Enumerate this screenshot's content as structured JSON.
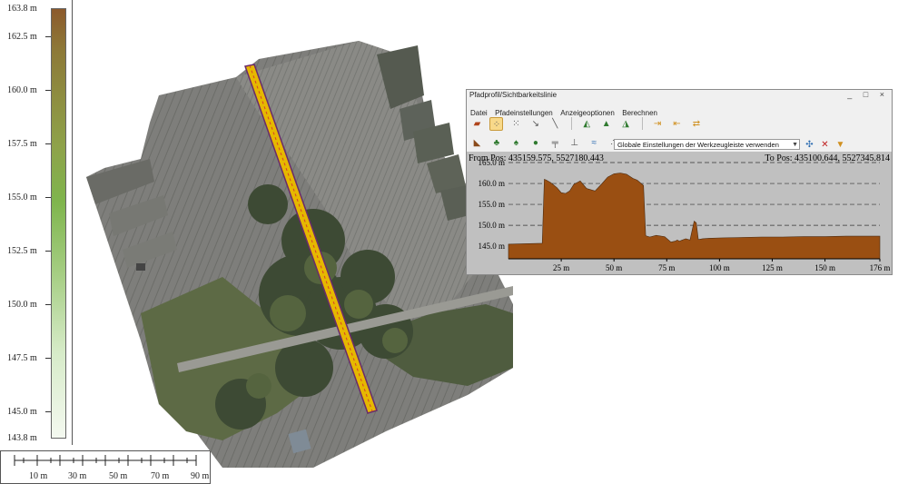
{
  "legend": {
    "labels": [
      "163.8 m",
      "162.5 m",
      "160.0 m",
      "157.5 m",
      "155.0 m",
      "152.5 m",
      "150.0 m",
      "147.5 m",
      "145.0 m",
      "143.8 m"
    ]
  },
  "scale": {
    "labels": [
      "10 m",
      "30 m",
      "50 m",
      "70 m",
      "90 m"
    ]
  },
  "window": {
    "title": "Pfadprofil/Sichtbarkeitslinie",
    "buttons": [
      "_",
      "□",
      "×"
    ],
    "menu": [
      "Datei",
      "Pfadeinstellungen",
      "Anzeigeoptionen",
      "Berechnen"
    ],
    "combo_value": "Globale Einstellungen der Werkzeugleiste verwenden",
    "from_pos": "From Pos: 435159.575, 5527180.443",
    "to_pos": "To Pos: 435100.644, 5527345.814"
  },
  "chart_data": {
    "type": "area",
    "title": "",
    "xlabel": "",
    "ylabel": "",
    "x_tick_labels": [
      "25 m",
      "50 m",
      "75 m",
      "100 m",
      "125 m",
      "150 m",
      "176 m"
    ],
    "y_tick_labels": [
      "165.0 m",
      "160.0 m",
      "155.0 m",
      "150.0 m",
      "145.0 m"
    ],
    "xlim": [
      0,
      176
    ],
    "ylim": [
      142,
      165
    ],
    "grid": "dashed horizontal",
    "fill_color": "#9a4f12",
    "x": [
      0,
      16,
      17,
      18,
      20,
      23,
      25,
      27,
      29,
      31,
      34,
      37,
      41,
      44,
      47,
      50,
      53,
      56,
      59,
      61,
      64,
      65,
      67,
      70,
      74,
      77,
      79,
      80,
      81,
      82,
      84,
      86,
      88,
      89,
      90,
      92,
      95,
      100,
      110,
      120,
      130,
      140,
      150,
      160,
      170,
      176
    ],
    "y": [
      145.5,
      145.7,
      161.0,
      160.8,
      160.2,
      159.0,
      157.8,
      157.6,
      158.2,
      159.8,
      160.6,
      158.8,
      158.2,
      159.8,
      161.5,
      162.3,
      162.5,
      162.2,
      161.2,
      160.8,
      159.5,
      147.5,
      147.2,
      147.6,
      147.3,
      146.0,
      146.2,
      146.5,
      146.2,
      146.4,
      146.8,
      146.5,
      151.0,
      150.6,
      146.6,
      146.8,
      146.9,
      147.0,
      147.1,
      147.2,
      147.2,
      147.3,
      147.3,
      147.4,
      147.4,
      147.4
    ]
  }
}
